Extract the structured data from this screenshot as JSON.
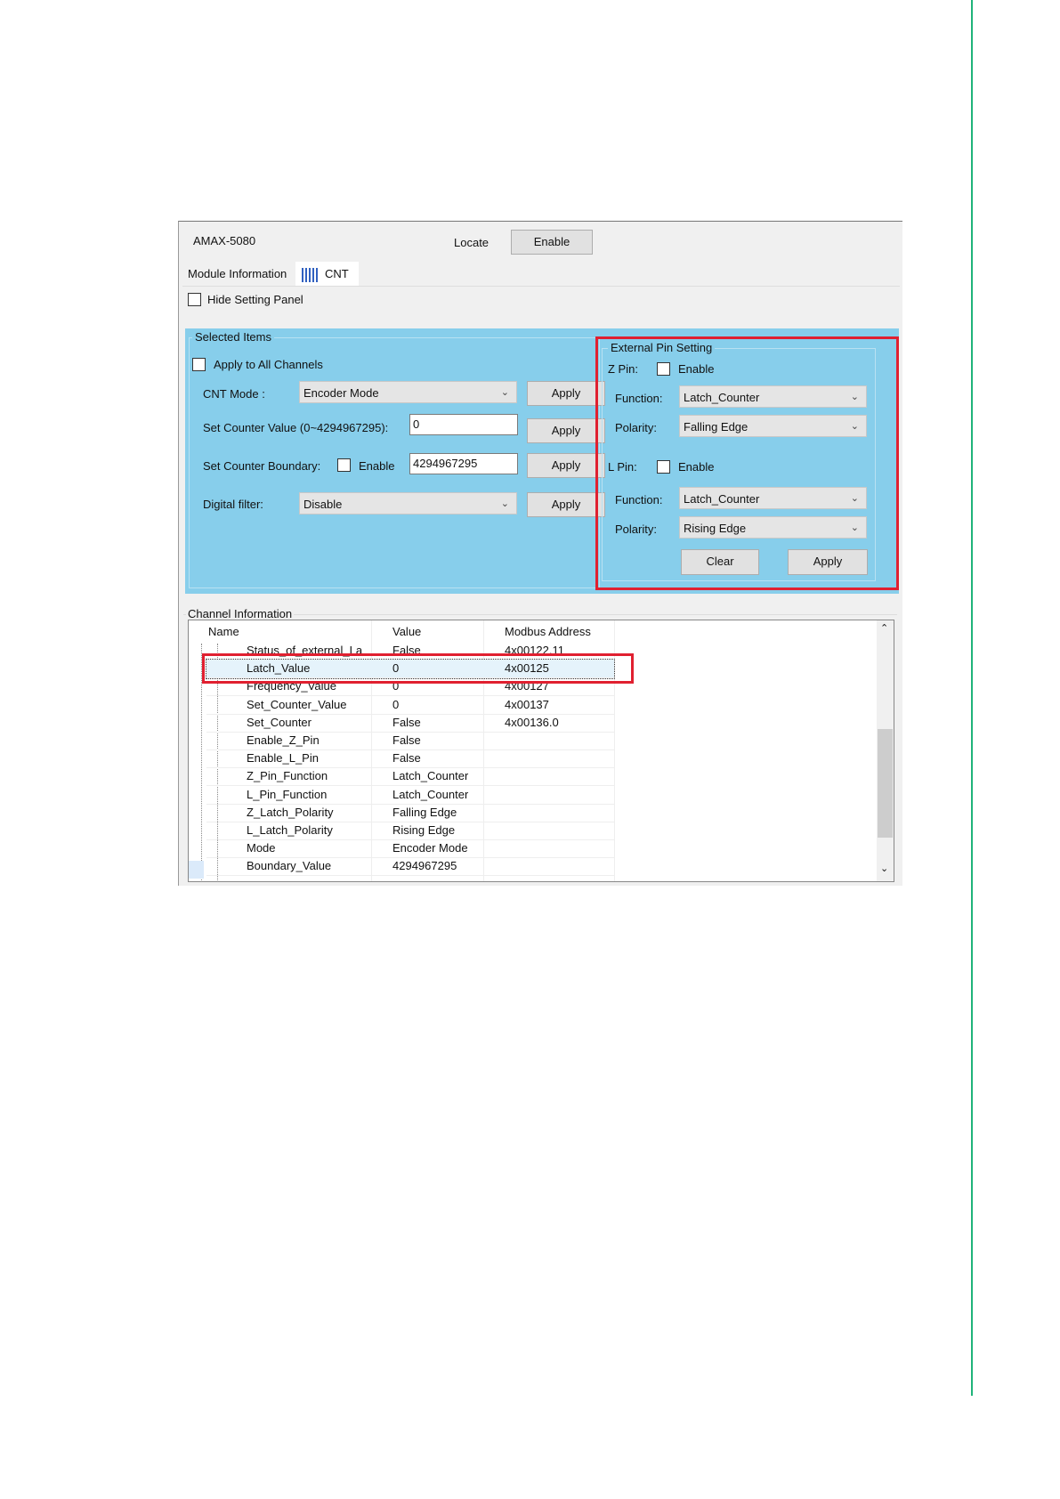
{
  "window": {
    "device": "AMAX-5080",
    "locate_label": "Locate",
    "enable_button": "Enable"
  },
  "tabs": [
    {
      "label": "Module Information",
      "active": false
    },
    {
      "label": "CNT",
      "active": true,
      "icon": "counter-icon"
    }
  ],
  "hide_setting_panel": {
    "label": "Hide Setting Panel",
    "checked": false
  },
  "selected_items": {
    "title": "Selected Items",
    "apply_all": {
      "label": "Apply to All Channels",
      "checked": false
    },
    "cnt_mode": {
      "label": "CNT Mode :",
      "value": "Encoder Mode",
      "apply": "Apply"
    },
    "counter_value": {
      "label": "Set Counter Value (0~4294967295):",
      "value": "0",
      "apply": "Apply"
    },
    "boundary": {
      "label": "Set Counter Boundary:",
      "enable_label": "Enable",
      "checked": false,
      "value": "4294967295",
      "apply": "Apply"
    },
    "digital_filter": {
      "label": "Digital filter:",
      "value": "Disable",
      "apply": "Apply"
    }
  },
  "external_pin": {
    "title": "External Pin Setting",
    "z_pin": {
      "label": "Z Pin:",
      "enable_label": "Enable",
      "checked": false,
      "function_label": "Function:",
      "function": "Latch_Counter",
      "polarity_label": "Polarity:",
      "polarity": "Falling Edge"
    },
    "l_pin": {
      "label": "L Pin:",
      "enable_label": "Enable",
      "checked": false,
      "function_label": "Function:",
      "function": "Latch_Counter",
      "polarity_label": "Polarity:",
      "polarity": "Rising Edge"
    },
    "clear": "Clear",
    "apply": "Apply"
  },
  "channel_info": {
    "title": "Channel Information",
    "columns": [
      "Name",
      "Value",
      "Modbus Address"
    ],
    "rows": [
      [
        "Status_of_external_La",
        "False",
        "4x00122.11"
      ],
      [
        "Latch_Value",
        "0",
        "4x00125"
      ],
      [
        "Frequency_Value",
        "0",
        "4x00127"
      ],
      [
        "Set_Counter_Value",
        "0",
        "4x00137"
      ],
      [
        "Set_Counter",
        "False",
        "4x00136.0"
      ],
      [
        "Enable_Z_Pin",
        "False",
        ""
      ],
      [
        "Enable_L_Pin",
        "False",
        ""
      ],
      [
        "Z_Pin_Function",
        "Latch_Counter",
        ""
      ],
      [
        "L_Pin_Function",
        "Latch_Counter",
        ""
      ],
      [
        "Z_Latch_Polarity",
        "Falling Edge",
        ""
      ],
      [
        "L_Latch_Polarity",
        "Rising Edge",
        ""
      ],
      [
        "Mode",
        "Encoder Mode",
        ""
      ],
      [
        "Boundary_Value",
        "4294967295",
        ""
      ]
    ],
    "selected_row": "Latch_Value"
  },
  "colors": {
    "panel_blue": "#87ceeb",
    "highlight_red": "#e02030",
    "page_rule": "#1fb37a"
  }
}
